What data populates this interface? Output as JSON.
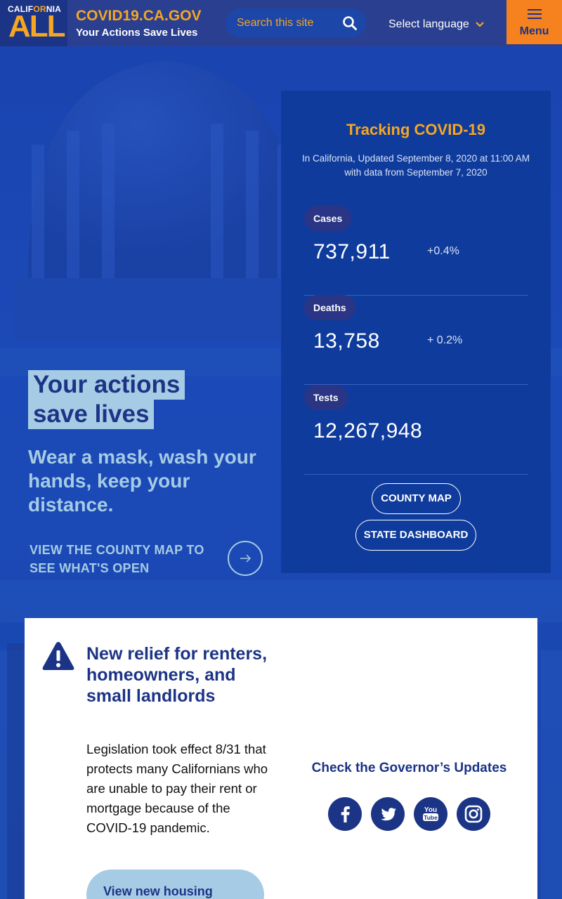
{
  "header": {
    "logo_top_part1": "CALIF",
    "logo_top_part2": "OR",
    "logo_top_part3": "NIA",
    "logo_main": "ALL",
    "site_title": "COVID19.CA.GOV",
    "site_subtitle": "Your Actions Save Lives",
    "search_placeholder": "Search this site",
    "language_label": "Select language",
    "menu_label": "Menu"
  },
  "hero": {
    "headline_line1": "Your actions",
    "headline_line2": "save lives",
    "subheadline": "Wear a mask, wash your hands, keep your distance.",
    "county_link": "VIEW THE COUNTY MAP TO SEE WHAT'S OPEN"
  },
  "tracking": {
    "title": "Tracking COVID-19",
    "updated": "In California, Updated September 8, 2020 at 11:00 AM with data from September 7, 2020",
    "stats": [
      {
        "label": "Cases",
        "value": "737,911",
        "change": "+0.4%"
      },
      {
        "label": "Deaths",
        "value": "13,758",
        "change": "+ 0.2%"
      },
      {
        "label": "Tests",
        "value": "12,267,948",
        "change": ""
      }
    ],
    "county_map_button": "COUNTY MAP",
    "state_dashboard_button": "STATE DASHBOARD"
  },
  "alert": {
    "title": "New relief for renters, homeowners, and small landlords",
    "body": "Legislation took effect 8/31 that protects many Californians who are unable to pay their rent or mortgage because of the COVID-19 pandemic.",
    "button": "View new housing"
  },
  "governor": {
    "title": "Check the Governor’s Updates",
    "social_icons": [
      "facebook-icon",
      "twitter-icon",
      "youtube-icon",
      "instagram-icon"
    ]
  },
  "colors": {
    "brand_navy": "#1c3486",
    "accent_orange": "#f5a623",
    "menu_orange": "#f5821f",
    "light_blue": "#a6cbe4",
    "card_blue": "#0f3c9c"
  }
}
